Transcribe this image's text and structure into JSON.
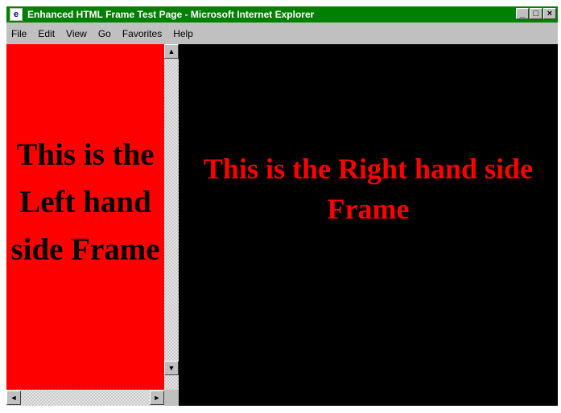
{
  "window": {
    "title": "Enhanced HTML Frame Test Page - Microsoft Internet Explorer",
    "icon": "ie-icon",
    "buttons": {
      "minimize": "_",
      "maximize": "□",
      "close": "×"
    }
  },
  "menubar": {
    "items": [
      {
        "label": "File"
      },
      {
        "label": "Edit"
      },
      {
        "label": "View"
      },
      {
        "label": "Go"
      },
      {
        "label": "Favorites"
      },
      {
        "label": "Help"
      }
    ]
  },
  "left_frame": {
    "text": "This is the Left hand side Frame",
    "background": "#ff0000",
    "text_color": "#000000"
  },
  "right_frame": {
    "text": "This is the Right hand side Frame",
    "background": "#000000",
    "text_color": "#ff0000"
  },
  "colors": {
    "titlebar": "#008000",
    "chrome": "#c0c0c0"
  }
}
